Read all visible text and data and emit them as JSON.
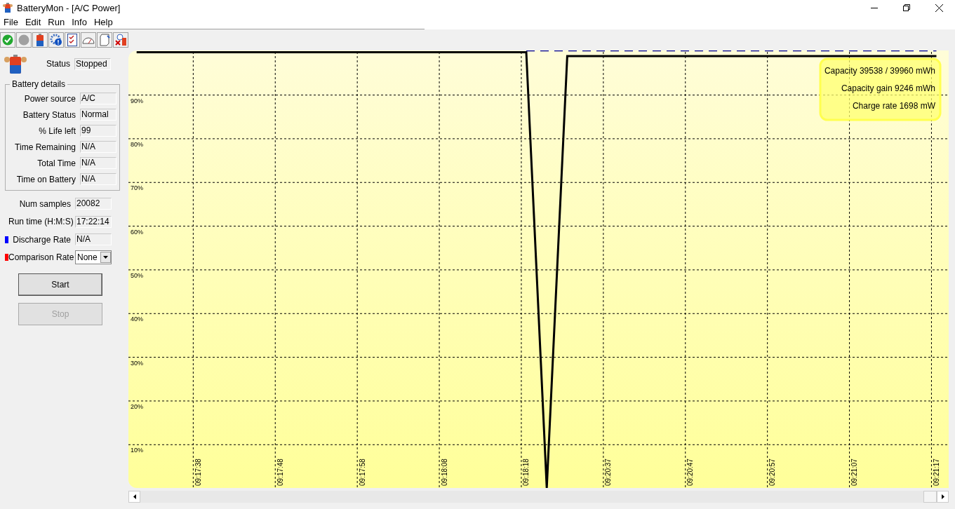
{
  "window": {
    "title": "BatteryMon - [A/C Power]"
  },
  "menu": [
    "File",
    "Edit",
    "Run",
    "Info",
    "Help"
  ],
  "status": {
    "label": "Status",
    "value": "Stopped"
  },
  "battery_details": {
    "title": "Battery details",
    "fields": [
      {
        "label": "Power source",
        "value": "A/C"
      },
      {
        "label": "Battery Status",
        "value": "Normal"
      },
      {
        "label": "% Life left",
        "value": "99"
      },
      {
        "label": "Time Remaining",
        "value": "N/A"
      },
      {
        "label": "Total Time",
        "value": "N/A"
      },
      {
        "label": "Time on Battery",
        "value": "N/A"
      }
    ]
  },
  "stats": [
    {
      "label": "Num samples",
      "value": "20082",
      "kind": "text"
    },
    {
      "label": "Run time (H:M:S)",
      "value": "17:22:14",
      "kind": "text"
    },
    {
      "label": "Discharge Rate",
      "value": "N/A",
      "kind": "text",
      "color": "#0000ff"
    },
    {
      "label": "Comparison Rate",
      "value": "None",
      "kind": "dropdown",
      "color": "#ff0000"
    }
  ],
  "buttons": [
    {
      "label": "Start",
      "disabled": false
    },
    {
      "label": "Stop",
      "disabled": true
    }
  ],
  "chart": {
    "chart_data": {
      "type": "line",
      "categories": [
        null,
        null,
        null,
        "09:17:38",
        null,
        null,
        null,
        "09:17:48",
        null,
        null,
        null,
        "09:17:58",
        null,
        null,
        null,
        "09:18:08",
        null,
        null,
        null,
        "09:18:18",
        null,
        null,
        null,
        "09:20:37",
        null,
        null,
        null,
        "09:20:47",
        null,
        null,
        null,
        "09:20:57",
        null,
        null,
        null,
        "09:21:07",
        null,
        null,
        null,
        "09:21:17"
      ],
      "series": [
        {
          "color": "#000000",
          "values": [
            101,
            101,
            101,
            101,
            101,
            101,
            101,
            101,
            101,
            101,
            101,
            101,
            101,
            101,
            101,
            101,
            101,
            101,
            101,
            101,
            1.3,
            100.1,
            100.1,
            100.1,
            100.1,
            100.1,
            100.1,
            100.1,
            100.1,
            100.1,
            100.1,
            100.1,
            100.1,
            100.1,
            100.1,
            100.1,
            100.1,
            100.1,
            100.1,
            100.1
          ]
        },
        {
          "color": "#00008b",
          "line_style": "dashed",
          "values": [
            null,
            null,
            null,
            null,
            null,
            null,
            null,
            null,
            null,
            null,
            null,
            null,
            null,
            null,
            null,
            null,
            null,
            null,
            null,
            101.3,
            101.3,
            101.3,
            101.3,
            101.3,
            101.3,
            101.3,
            101.3,
            101.3,
            101.3,
            101.3,
            101.3,
            101.3,
            101.3,
            101.3,
            101.3,
            101.3,
            101.3,
            101.3,
            101.3,
            101.3
          ]
        }
      ],
      "yticks": [
        {
          "value": 10,
          "label": "10%"
        },
        {
          "value": 20,
          "label": "20%"
        },
        {
          "value": 30,
          "label": "30%"
        },
        {
          "value": 40,
          "label": "40%"
        },
        {
          "value": 50,
          "label": "50%"
        },
        {
          "value": 60,
          "label": "60%"
        },
        {
          "value": 70,
          "label": "70%"
        },
        {
          "value": 80,
          "label": "80%"
        },
        {
          "value": 90,
          "label": "90%"
        }
      ],
      "ylim": [
        1.3,
        101.4
      ],
      "annotations": [
        "Capacity 39538 / 39960 mWh",
        "Capacity gain 9246 mWh",
        "Charge rate 1698 mW"
      ]
    }
  }
}
